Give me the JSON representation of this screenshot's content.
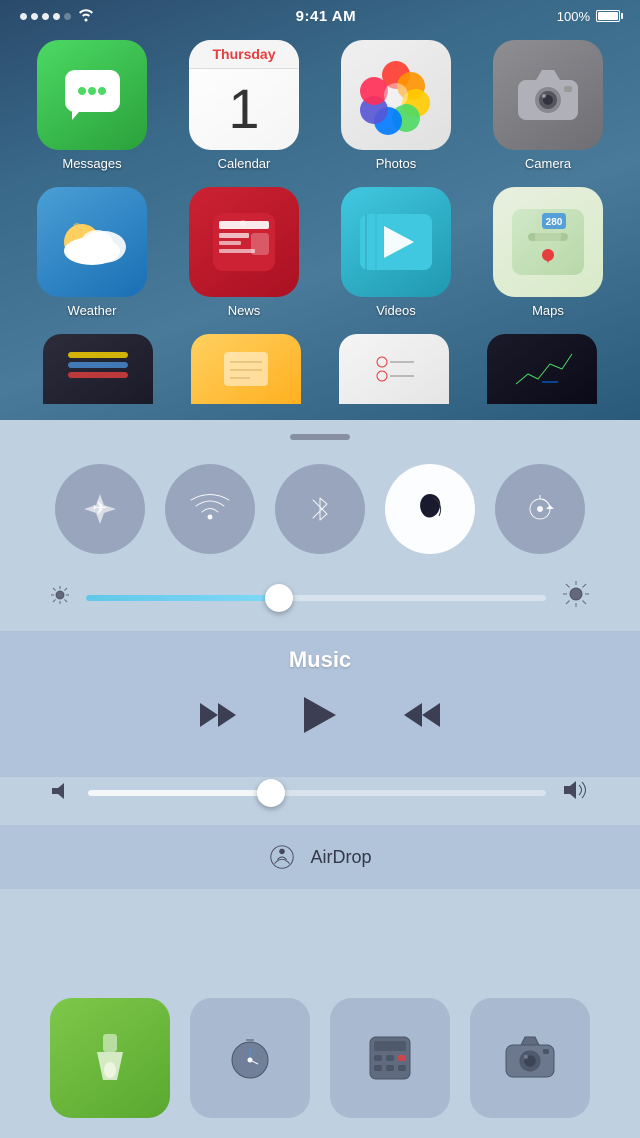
{
  "status": {
    "time": "9:41 AM",
    "battery": "100%"
  },
  "homescreen": {
    "apps": [
      {
        "id": "messages",
        "label": "Messages",
        "icon": "messages"
      },
      {
        "id": "calendar",
        "label": "Calendar",
        "icon": "calendar",
        "day": "Thursday",
        "date": "1"
      },
      {
        "id": "photos",
        "label": "Photos",
        "icon": "photos"
      },
      {
        "id": "camera",
        "label": "Camera",
        "icon": "camera"
      },
      {
        "id": "weather",
        "label": "Weather",
        "icon": "weather"
      },
      {
        "id": "news",
        "label": "News",
        "icon": "news"
      },
      {
        "id": "videos",
        "label": "Videos",
        "icon": "videos"
      },
      {
        "id": "maps",
        "label": "Maps",
        "icon": "maps"
      }
    ],
    "partial_apps": [
      {
        "id": "wallet",
        "label": "",
        "icon": "wallet"
      },
      {
        "id": "notes",
        "label": "",
        "icon": "notes"
      },
      {
        "id": "reminders",
        "label": "",
        "icon": "reminders"
      },
      {
        "id": "stocks",
        "label": "",
        "icon": "stocks"
      }
    ]
  },
  "control_center": {
    "handle_label": "",
    "toggles": [
      {
        "id": "airplane",
        "label": "Airplane Mode",
        "active": false,
        "symbol": "✈"
      },
      {
        "id": "wifi",
        "label": "Wi-Fi",
        "active": false
      },
      {
        "id": "bluetooth",
        "label": "Bluetooth",
        "active": false
      },
      {
        "id": "do-not-disturb",
        "label": "Do Not Disturb",
        "active": true
      },
      {
        "id": "rotation-lock",
        "label": "Rotation Lock",
        "active": false
      }
    ],
    "brightness": {
      "label": "Brightness",
      "value": 42
    },
    "music": {
      "title": "Music",
      "controls": {
        "rewind_label": "⏮",
        "play_label": "▶",
        "forward_label": "⏭"
      }
    },
    "volume": {
      "label": "Volume",
      "value": 40
    },
    "airdrop": {
      "label": "AirDrop"
    },
    "quick_launch": [
      {
        "id": "flashlight",
        "label": "Flashlight",
        "icon": "🔦",
        "active": true
      },
      {
        "id": "timer",
        "label": "Timer",
        "icon": "⏱"
      },
      {
        "id": "calculator",
        "label": "Calculator",
        "icon": "🧮"
      },
      {
        "id": "camera-ql",
        "label": "Camera",
        "icon": "📷"
      }
    ]
  }
}
